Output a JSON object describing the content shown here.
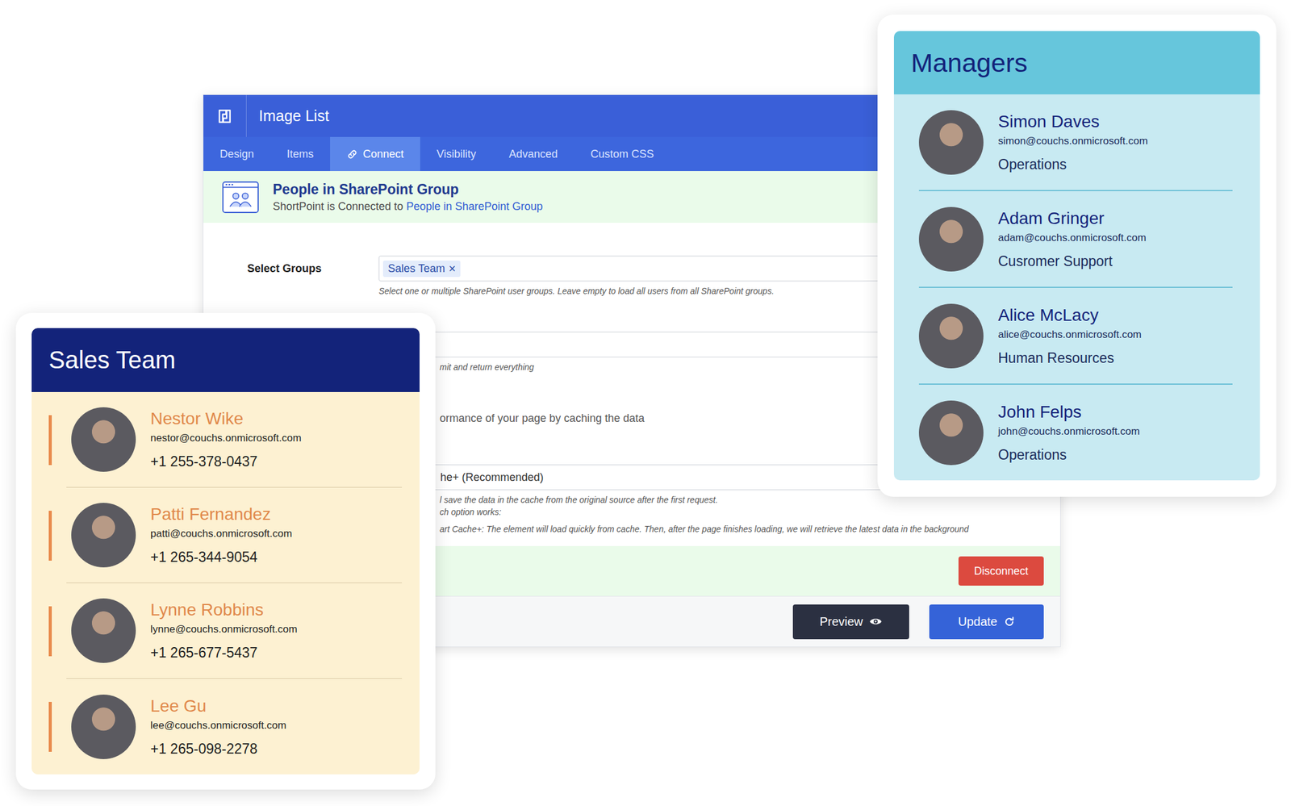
{
  "window": {
    "title": "Image List"
  },
  "tabs": [
    {
      "label": "Design",
      "selected": false
    },
    {
      "label": "Items",
      "selected": false
    },
    {
      "label": "Connect",
      "selected": true
    },
    {
      "label": "Visibility",
      "selected": false
    },
    {
      "label": "Advanced",
      "selected": false
    },
    {
      "label": "Custom CSS",
      "selected": false
    }
  ],
  "connection": {
    "title": "People in SharePoint Group",
    "subtitle_prefix": "ShortPoint is Connected to ",
    "subtitle_link": "People in SharePoint Group"
  },
  "select_groups": {
    "label": "Select Groups",
    "chips": [
      {
        "label": "Sales Team",
        "remove": "×"
      }
    ],
    "help": "Select one or multiple SharePoint user groups. Leave empty to load all users from all SharePoint groups."
  },
  "limit_help": "mit and return everything",
  "cache_help": "ormance of your page by caching the data",
  "cache_field": {
    "value": "he+ (Recommended)"
  },
  "cache_notes": [
    "l save the data in the cache from the original source after the first request.",
    "ch option works:",
    "art Cache+: The element will load quickly from cache. Then, after the page finishes loading, we will retrieve the latest data in the background"
  ],
  "buttons": {
    "disconnect": "Disconnect",
    "preview": "Preview",
    "update": "Update"
  },
  "sales_team": {
    "title": "Sales Team",
    "members": [
      {
        "name": "Nestor Wike",
        "email": "nestor@couchs.onmicrosoft.com",
        "phone": "+1 255-378-0437"
      },
      {
        "name": "Patti Fernandez",
        "email": "patti@couchs.onmicrosoft.com",
        "phone": "+1 265-344-9054"
      },
      {
        "name": "Lynne Robbins",
        "email": "lynne@couchs.onmicrosoft.com",
        "phone": "+1 265-677-5437"
      },
      {
        "name": "Lee Gu",
        "email": "lee@couchs.onmicrosoft.com",
        "phone": "+1 265-098-2278"
      }
    ]
  },
  "managers": {
    "title": "Managers",
    "members": [
      {
        "name": "Simon Daves",
        "email": "simon@couchs.onmicrosoft.com",
        "department": "Operations"
      },
      {
        "name": "Adam Gringer",
        "email": "adam@couchs.onmicrosoft.com",
        "department": "Cusromer Support"
      },
      {
        "name": "Alice McLacy",
        "email": "alice@couchs.onmicrosoft.com",
        "department": "Human Resources"
      },
      {
        "name": "John Felps",
        "email": "john@couchs.onmicrosoft.com",
        "department": "Operations"
      }
    ]
  }
}
